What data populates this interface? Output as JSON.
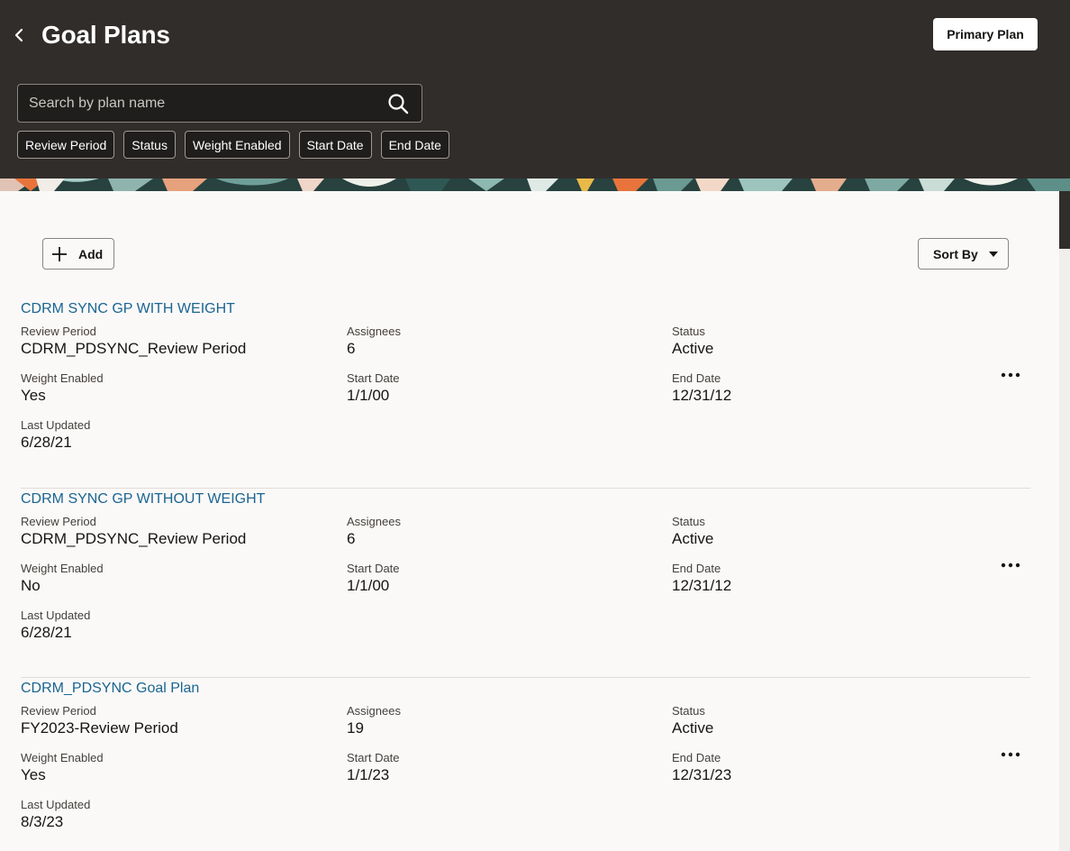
{
  "header": {
    "title": "Goal Plans",
    "primary_plan_label": "Primary Plan"
  },
  "search": {
    "placeholder": "Search by plan name",
    "value": ""
  },
  "filters": [
    "Review Period",
    "Status",
    "Weight Enabled",
    "Start Date",
    "End Date"
  ],
  "toolbar": {
    "add_label": "Add",
    "sort_label": "Sort By"
  },
  "plans": [
    {
      "name": "CDRM SYNC GP WITH WEIGHT",
      "review_period": "CDRM_PDSYNC_Review Period",
      "assignees": "6",
      "status": "Active",
      "weight_enabled": "Yes",
      "start_date": "1/1/00",
      "end_date": "12/31/12",
      "last_updated": "6/28/21"
    },
    {
      "name": "CDRM SYNC GP WITHOUT WEIGHT",
      "review_period": "CDRM_PDSYNC_Review Period",
      "assignees": "6",
      "status": "Active",
      "weight_enabled": "No",
      "start_date": "1/1/00",
      "end_date": "12/31/12",
      "last_updated": "6/28/21"
    },
    {
      "name": "CDRM_PDSYNC Goal Plan",
      "review_period": "FY2023-Review Period",
      "assignees": "19",
      "status": "Active",
      "weight_enabled": "Yes",
      "start_date": "1/1/23",
      "end_date": "12/31/23",
      "last_updated": "8/3/23"
    }
  ],
  "labels": {
    "review_period": "Review Period",
    "assignees": "Assignees",
    "status": "Status",
    "weight_enabled": "Weight Enabled",
    "start_date": "Start Date",
    "end_date": "End Date",
    "last_updated": "Last Updated"
  },
  "colors": {
    "header_bg": "#312d2a",
    "content_bg": "#faf9f8",
    "link": "#1b6591"
  },
  "icons": {
    "back": "chevron-left-icon",
    "search": "search-icon",
    "add": "plus-icon",
    "sort": "caret-down-icon",
    "more": "more-horizontal-icon"
  }
}
